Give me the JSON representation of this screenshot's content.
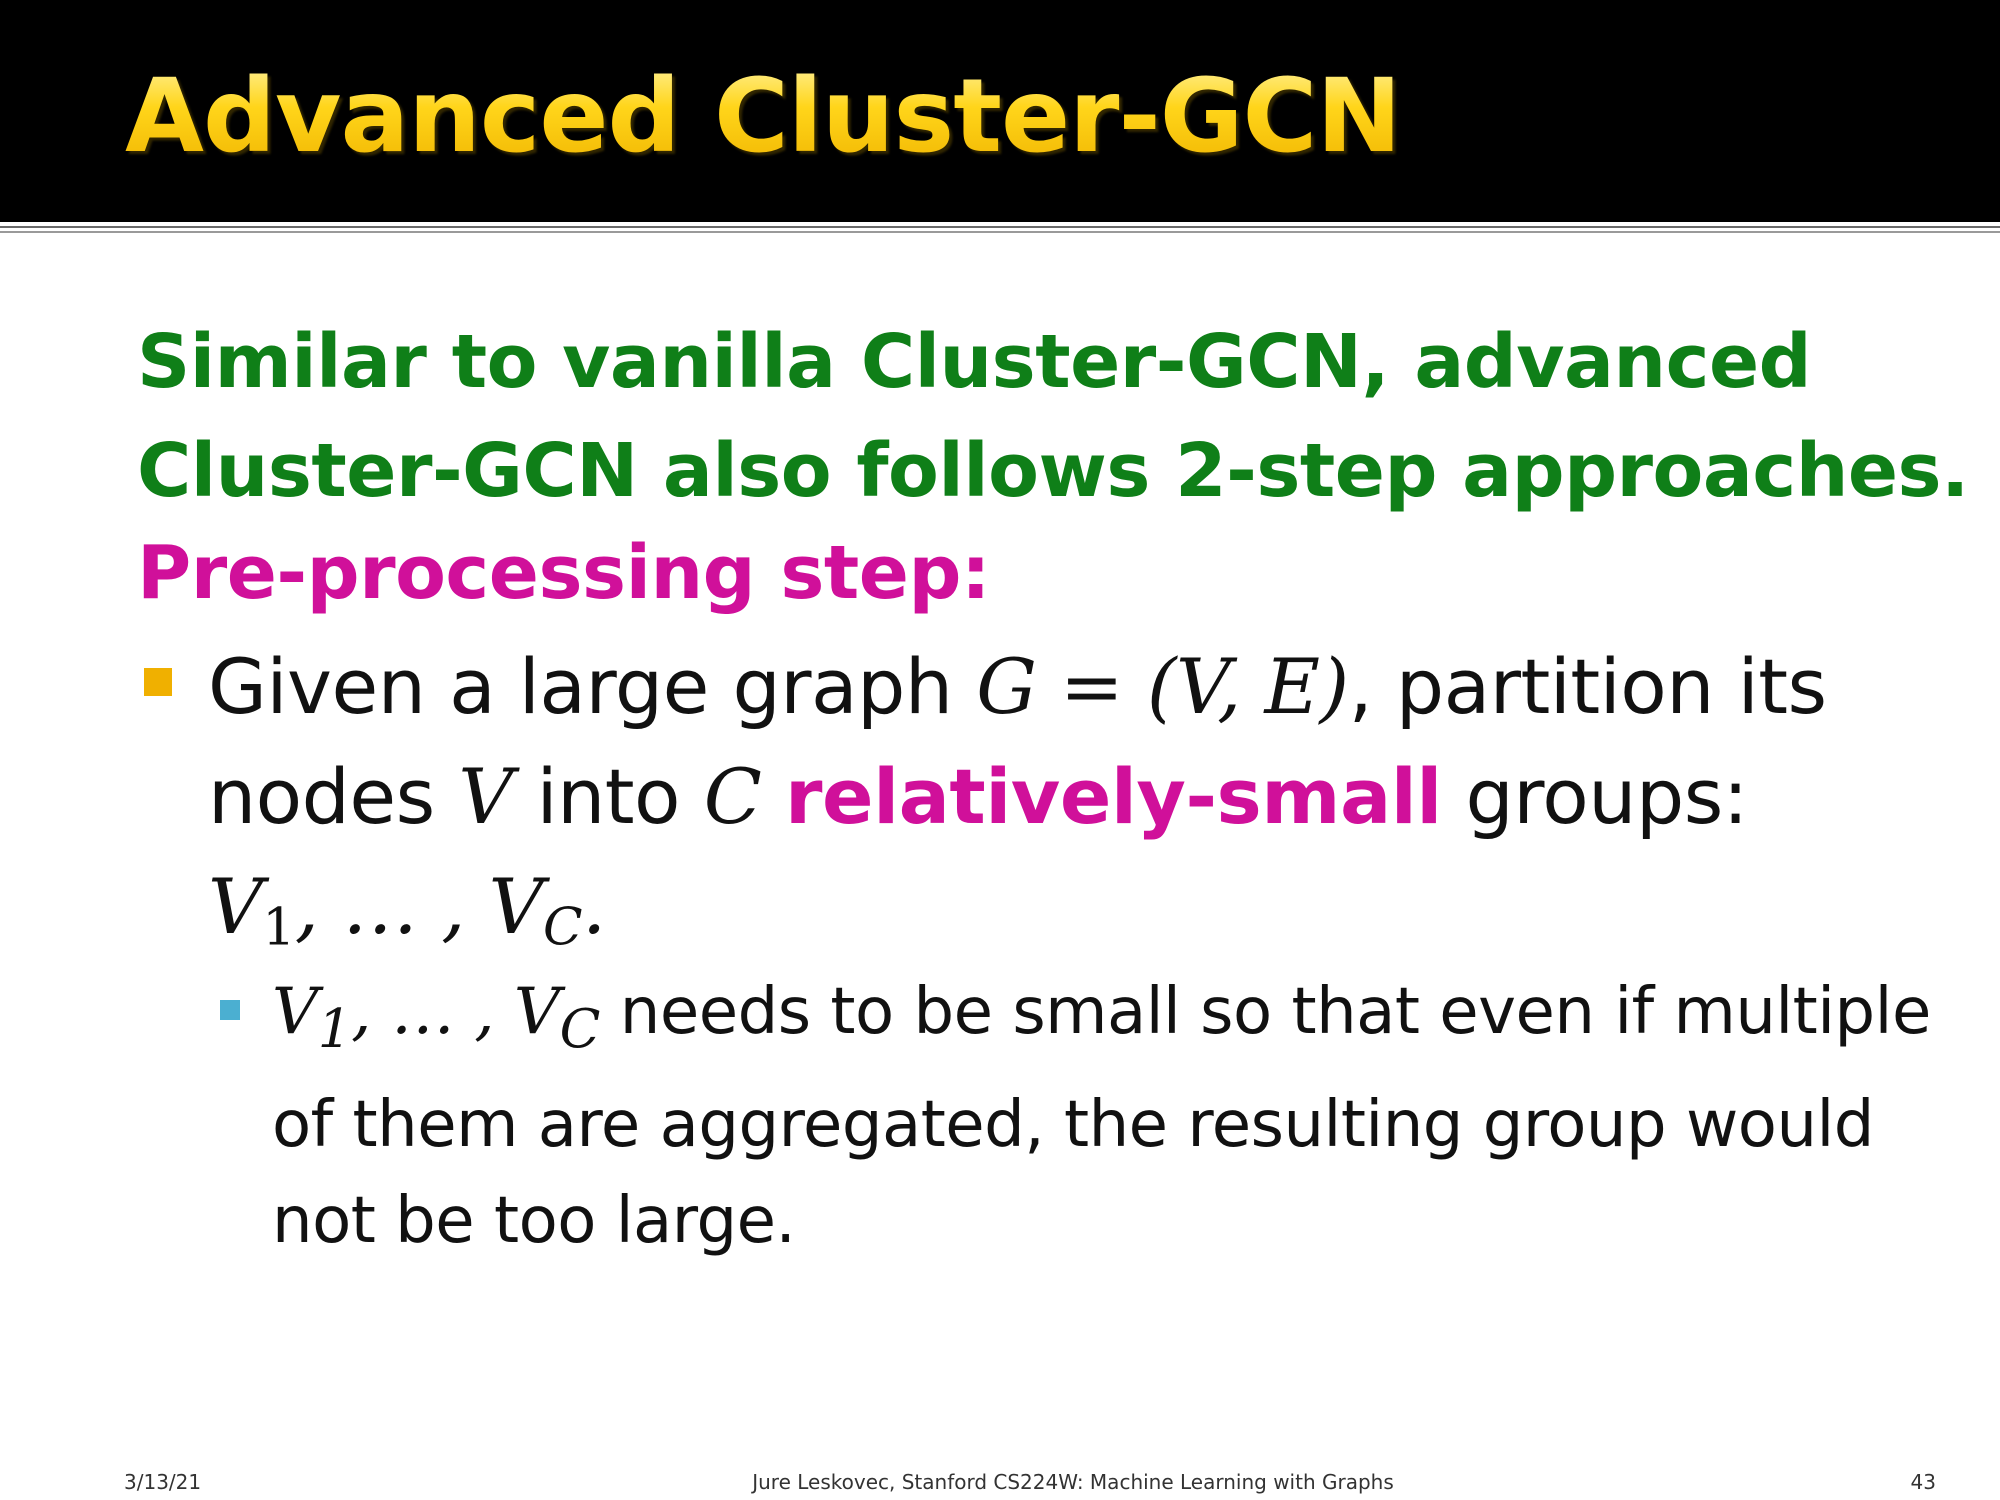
{
  "slide": {
    "title": "Advanced Cluster-GCN",
    "intro": {
      "line1": "Similar to vanilla Cluster-GCN, advanced",
      "line2": "Cluster-GCN also follows 2-step approaches."
    },
    "section_heading": "Pre-processing step:",
    "bullet": {
      "l1_pre": "Given a large graph ",
      "l1_math": "G = (V, E)",
      "l1_post": ", partition its",
      "l2_pre": "nodes ",
      "l2_math1": "V",
      "l2_mid": " into ",
      "l2_math2": "C",
      "l2_space": " ",
      "l2_highlight": "relatively-small",
      "l2_post": " groups:",
      "l3_v": "V",
      "l3_sub1": "1",
      "l3_ellipsis": ", … , ",
      "l3_v2": "V",
      "l3_sub2": "C",
      "l3_period": "."
    },
    "sub_bullet": {
      "l1_v": "V",
      "l1_sub1": "1",
      "l1_ellipsis": ", … , ",
      "l1_v2": "V",
      "l1_sub2": "C",
      "l1_text": " needs to be small so that even if multiple",
      "l2": "of them are aggregated, the resulting group would",
      "l3": "not be too large."
    },
    "colors": {
      "title": "#f2c200",
      "intro": "#0f7f18",
      "highlight": "#d0109a",
      "bullet_main": "#f0b000",
      "bullet_sub": "#4bafd1"
    }
  },
  "footer": {
    "date": "3/13/21",
    "center": "Jure Leskovec, Stanford CS224W: Machine Learning with Graphs",
    "page": "43"
  }
}
